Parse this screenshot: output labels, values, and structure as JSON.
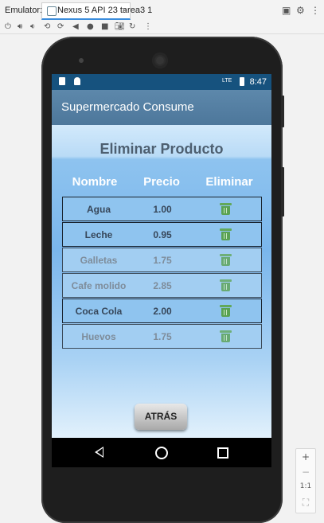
{
  "emulator": {
    "label": "Emulator:",
    "tab_label": "Nexus 5 API 23 tarea3 1",
    "tab_close": "×",
    "toolbar_icons": [
      "power-icon",
      "volume-up-icon",
      "volume-down-icon",
      "rotate-left-icon",
      "rotate-right-icon",
      "back-icon",
      "home-icon",
      "overview-icon",
      "camera-icon",
      "replay-icon",
      "more-icon"
    ],
    "side_controls": {
      "zoom_in": "+",
      "zoom_out": "−",
      "ratio": "1:1"
    }
  },
  "status_bar": {
    "time": "8:47",
    "network": "LTE"
  },
  "app_bar": {
    "title": "Supermercado Consume"
  },
  "page": {
    "title": "Eliminar Producto",
    "columns": [
      "Nombre",
      "Precio",
      "Eliminar"
    ],
    "rows": [
      {
        "name": "Agua",
        "price": "1.00",
        "enabled": true
      },
      {
        "name": "Leche",
        "price": "0.95",
        "enabled": true
      },
      {
        "name": "Galletas",
        "price": "1.75",
        "enabled": false
      },
      {
        "name": "Cafe molido",
        "price": "2.85",
        "enabled": false
      },
      {
        "name": "Coca Cola",
        "price": "2.00",
        "enabled": true
      },
      {
        "name": "Huevos",
        "price": "1.75",
        "enabled": false
      }
    ],
    "back_button": "ATRÁS"
  },
  "colors": {
    "row_text_enabled": "#37475a",
    "row_text_disabled": "#7e8c9a",
    "row_bg_enabled": "#8fc4ef",
    "row_bg_disabled": "#a2cef2",
    "trash": "#5aa253"
  }
}
